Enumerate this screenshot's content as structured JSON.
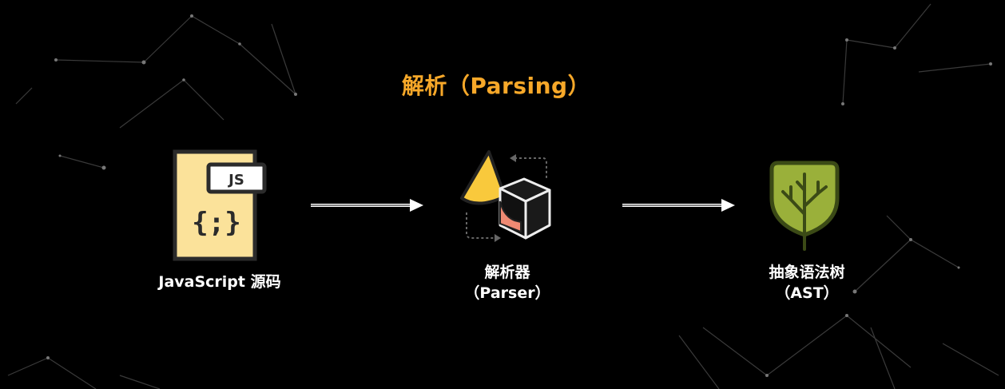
{
  "title": "解析（Parsing）",
  "nodes": {
    "source": {
      "label": "JavaScript 源码",
      "badge": "JS",
      "glyph": "{;}"
    },
    "parser": {
      "label_line1": "解析器",
      "label_line2": "（Parser）"
    },
    "ast": {
      "label_line1": "抽象语法树",
      "label_line2": "（AST）"
    }
  },
  "colors": {
    "title": "#f7a829",
    "file_fill": "#fbe29a",
    "file_stroke": "#2b2b2b",
    "cone": "#f9c93c",
    "cube_face": "#ef8a73",
    "tree_fill": "#9ab03a",
    "tree_stroke": "#3b4a16",
    "arrow": "#ffffff",
    "background": "#000000"
  },
  "icons": [
    "js-file-icon",
    "parser-shapes-icon",
    "tree-icon"
  ]
}
